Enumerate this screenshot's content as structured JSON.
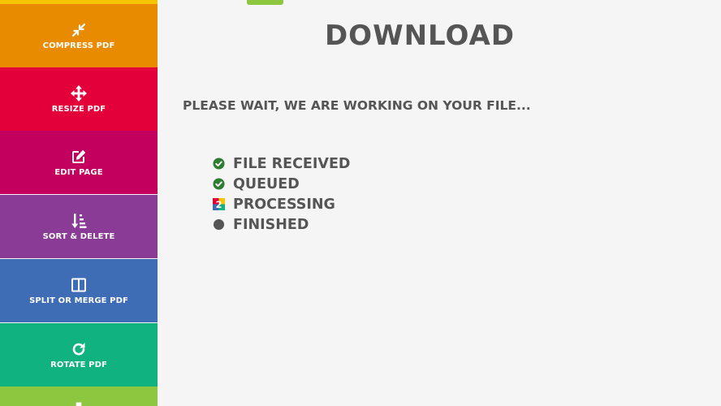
{
  "sidebar": {
    "items": [
      {
        "label": "COMPRESS PDF",
        "icon": "compress-icon",
        "color": "#e98b00"
      },
      {
        "label": "RESIZE PDF",
        "icon": "arrows-move-icon",
        "color": "#e3003a"
      },
      {
        "label": "EDIT PAGE",
        "icon": "edit-icon",
        "color": "#c3005d"
      },
      {
        "label": "SORT & DELETE",
        "icon": "sort-icon",
        "color": "#8a3b96"
      },
      {
        "label": "SPLIT OR MERGE PDF",
        "icon": "columns-icon",
        "color": "#3e6db6"
      },
      {
        "label": "ROTATE PDF",
        "icon": "rotate-icon",
        "color": "#10b27f"
      },
      {
        "label": "",
        "icon": "document-icon",
        "color": "#8dc63f"
      }
    ]
  },
  "main": {
    "title": "DOWNLOAD",
    "wait_message": "PLEASE WAIT, WE ARE WORKING ON YOUR FILE...",
    "steps": [
      {
        "label": "FILE RECEIVED",
        "status": "done",
        "icon": "check-circle-icon"
      },
      {
        "label": "QUEUED",
        "status": "done",
        "icon": "check-circle-icon"
      },
      {
        "label": "PROCESSING",
        "status": "in-progress",
        "icon": "processing-icon"
      },
      {
        "label": "FINISHED",
        "status": "pending",
        "icon": "circle-icon"
      }
    ]
  },
  "colors": {
    "text": "#555555",
    "check": "#2e7d32",
    "pending": "#555555",
    "accent": "#8dc63f"
  }
}
